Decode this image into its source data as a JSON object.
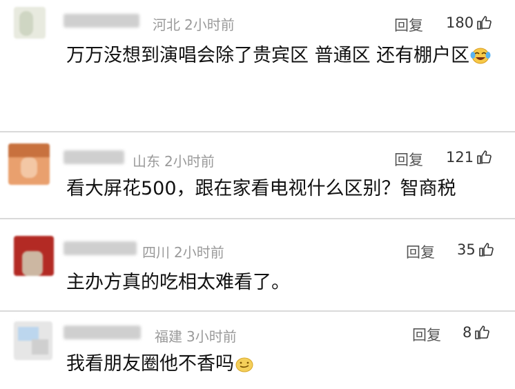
{
  "comments": [
    {
      "location": "河北",
      "time": "2小时前",
      "reply_label": "回复",
      "likes": "180",
      "text": "万万没想到演唱会除了贵宾区 普通区 还有棚户区",
      "emoji": "laughing-crying-emoji"
    },
    {
      "location": "山东",
      "time": "2小时前",
      "reply_label": "回复",
      "likes": "121",
      "text": "看大屏花500，跟在家看电视什么区别？智商税"
    },
    {
      "location": "四川",
      "time": "2小时前",
      "reply_label": "回复",
      "likes": "35",
      "text": "主办方真的吃相太难看了。"
    },
    {
      "location": "福建",
      "time": "3小时前",
      "reply_label": "回复",
      "likes": "8",
      "text": "我看朋友圈他不香吗",
      "emoji": "smirk-emoji"
    }
  ],
  "colors": {
    "meta": "#9a9a9a",
    "divider": "#d9d9d9",
    "text": "#111111"
  }
}
